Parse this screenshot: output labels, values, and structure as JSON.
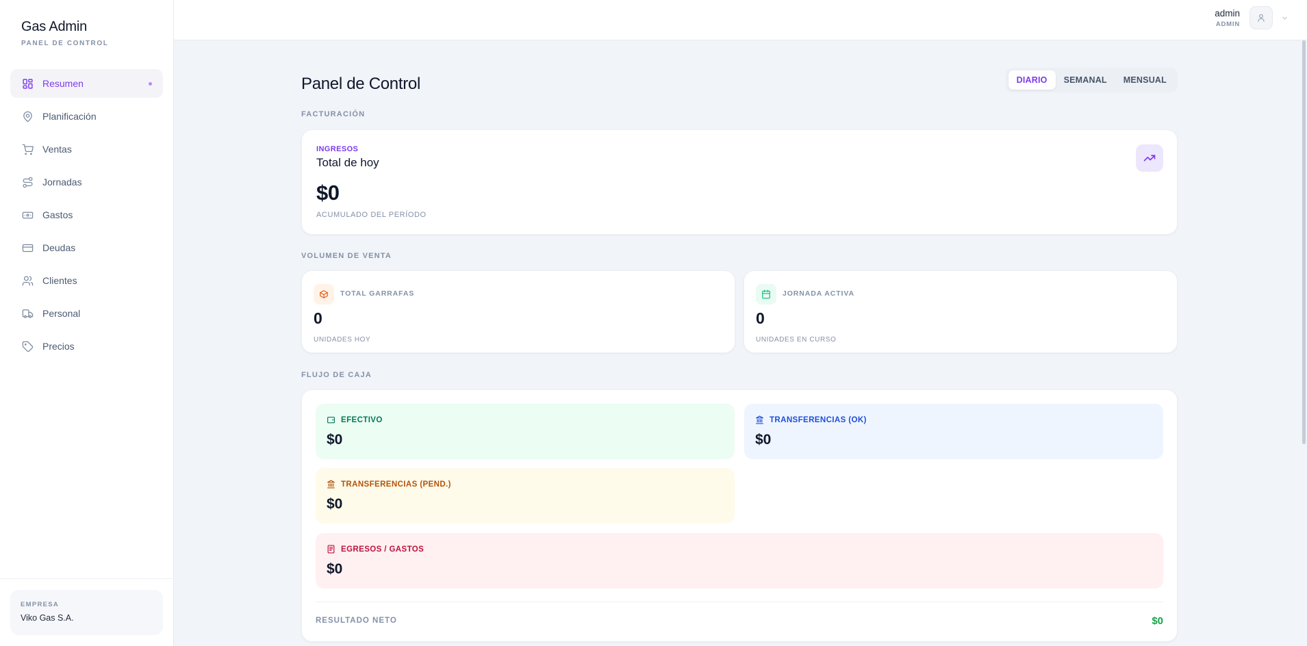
{
  "app": {
    "title": "Gas Admin",
    "subtitle": "PANEL DE CONTROL"
  },
  "sidebar": {
    "items": [
      {
        "label": "Resumen",
        "icon": "grid-icon",
        "active": true
      },
      {
        "label": "Planificación",
        "icon": "map-pin-icon"
      },
      {
        "label": "Ventas",
        "icon": "cart-icon"
      },
      {
        "label": "Jornadas",
        "icon": "route-icon"
      },
      {
        "label": "Gastos",
        "icon": "banknote-icon"
      },
      {
        "label": "Deudas",
        "icon": "credit-card-icon"
      },
      {
        "label": "Clientes",
        "icon": "users-icon"
      },
      {
        "label": "Personal",
        "icon": "truck-icon"
      },
      {
        "label": "Precios",
        "icon": "tag-icon"
      }
    ],
    "company": {
      "label": "EMPRESA",
      "name": "Viko Gas S.A."
    }
  },
  "topbar": {
    "user_name": "admin",
    "user_role": "ADMIN"
  },
  "page": {
    "title": "Panel de Control",
    "periods": [
      "DIARIO",
      "SEMANAL",
      "MENSUAL"
    ],
    "active_period": "DIARIO"
  },
  "billing": {
    "section": "FACTURACIÓN",
    "kicker": "INGRESOS",
    "title": "Total de hoy",
    "value": "$0",
    "note": "ACUMULADO DEL PERÍODO"
  },
  "volume": {
    "section": "VOLUMEN DE VENTA",
    "cards": [
      {
        "label": "TOTAL GARRAFAS",
        "value": "0",
        "note": "UNIDADES HOY",
        "icon": "box-icon",
        "color": "#ea580c"
      },
      {
        "label": "JORNADA ACTIVA",
        "value": "0",
        "note": "UNIDADES EN CURSO",
        "icon": "calendar-icon",
        "color": "#10b981"
      }
    ]
  },
  "cashflow": {
    "section": "FLUJO DE CAJA",
    "items": [
      {
        "label": "EFECTIVO",
        "value": "$0",
        "icon": "wallet-icon",
        "color": "#047857",
        "bg": "#ecfdf3"
      },
      {
        "label": "TRANSFERENCIAS (OK)",
        "value": "$0",
        "icon": "bank-icon",
        "color": "#1d4ed8",
        "bg": "#eff5ff"
      },
      {
        "label": "TRANSFERENCIAS (PEND.)",
        "value": "$0",
        "icon": "bank-icon",
        "color": "#b45309",
        "bg": "#fefbea"
      },
      {
        "label": "EGRESOS / GASTOS",
        "value": "$0",
        "icon": "receipt-icon",
        "color": "#be123c",
        "bg": "#fff0f1"
      }
    ],
    "net_label": "RESULTADO NETO",
    "net_value": "$0",
    "net_color": "#16a34a"
  }
}
